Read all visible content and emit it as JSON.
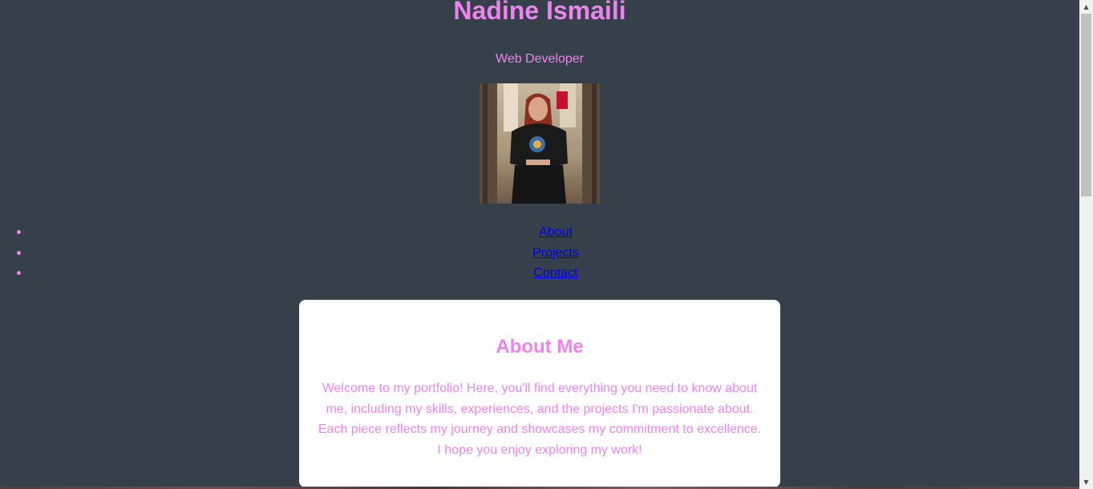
{
  "header": {
    "name": "Nadine Ismaili",
    "subtitle": "Web Developer",
    "photo_alt": "profile-photo"
  },
  "nav": {
    "items": [
      {
        "label": "About"
      },
      {
        "label": "Projects"
      },
      {
        "label": "Contact"
      }
    ]
  },
  "about": {
    "heading": "About Me",
    "text": "Welcome to my portfolio! Here, you'll find everything you need to know about me, including my skills, experiences, and the projects I'm passionate about. Each piece reflects my journey and showcases my commitment to excellence. I hope you enjoy exploring my work!"
  },
  "scrollbar": {
    "up_icon": "triangle-up-icon",
    "down_icon": "triangle-down-icon"
  },
  "colors": {
    "background": "#36404a",
    "accent": "#ee82ee",
    "link": "#0000ee",
    "card": "#ffffff"
  }
}
